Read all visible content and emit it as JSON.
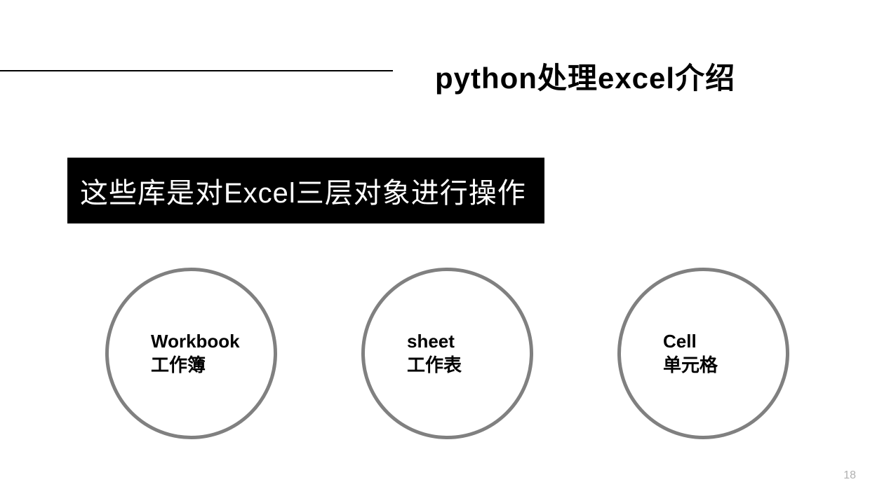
{
  "title": "python处理excel介绍",
  "subtitle": "这些库是对Excel三层对象进行操作",
  "circles": [
    {
      "en": "Workbook",
      "cn": "工作簿"
    },
    {
      "en": "sheet",
      "cn": "工作表"
    },
    {
      "en": "Cell",
      "cn": "单元格"
    }
  ],
  "page_number": "18"
}
